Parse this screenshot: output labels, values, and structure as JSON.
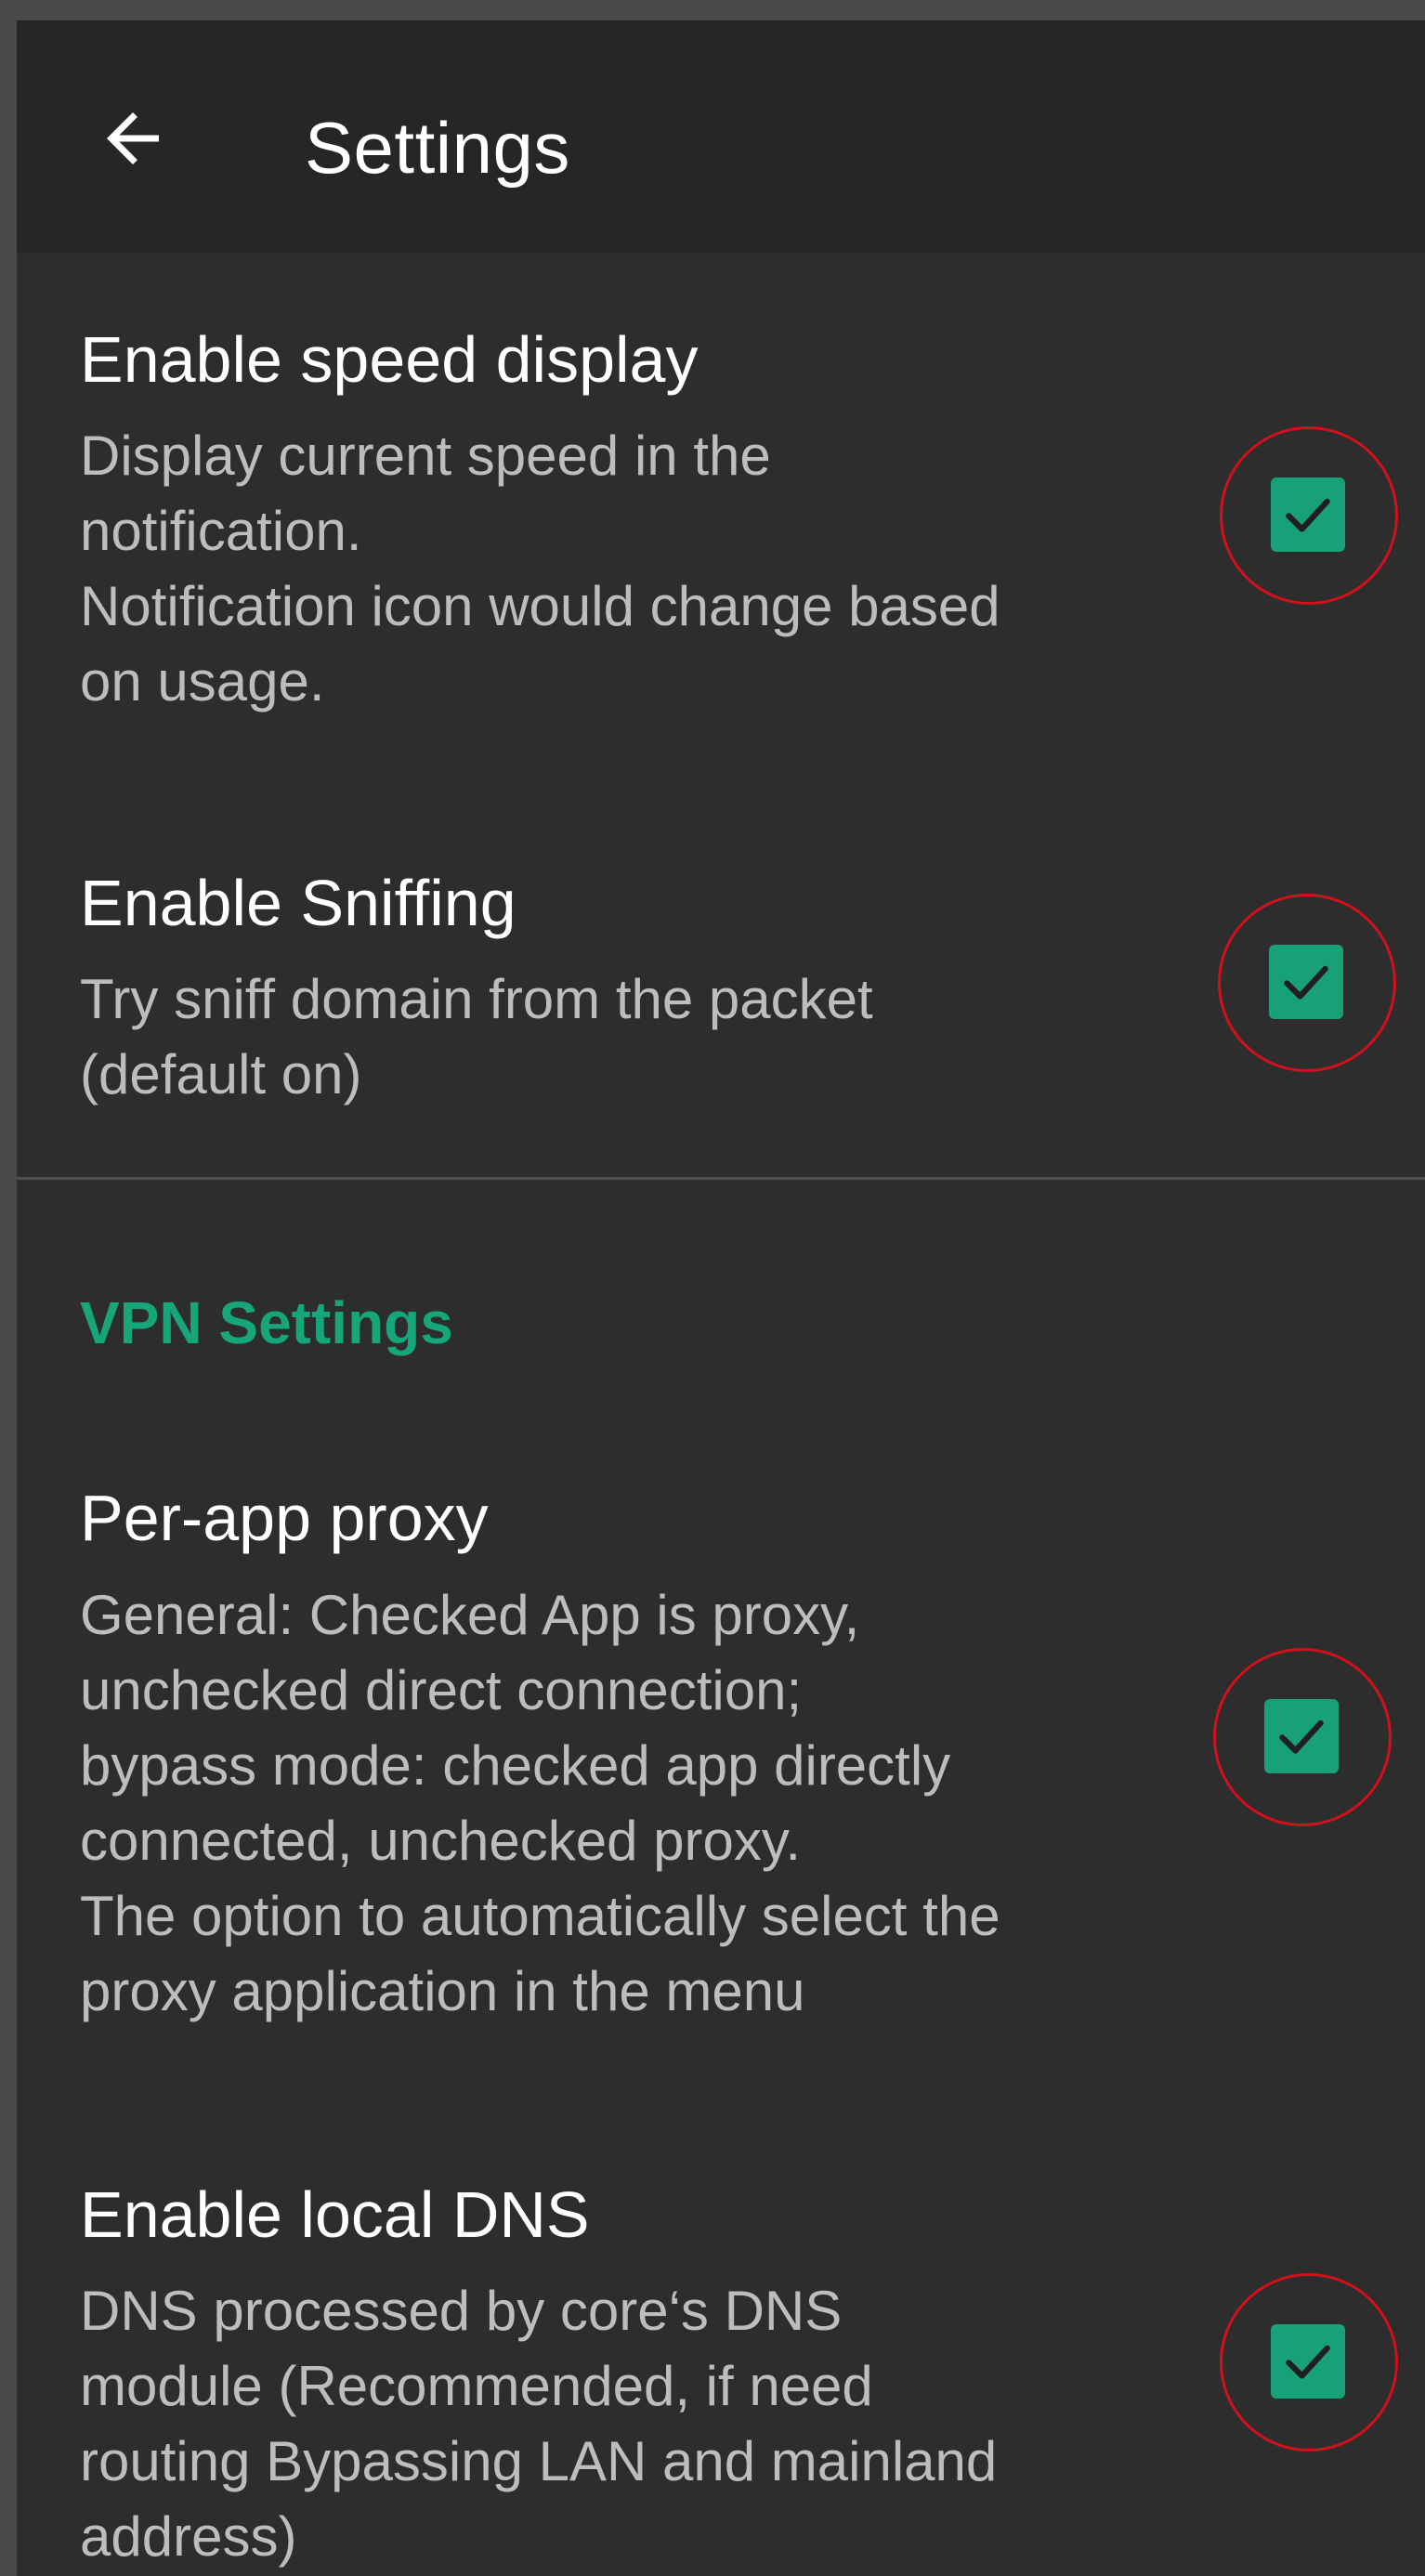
{
  "appbar": {
    "title": "Settings",
    "back_icon": "arrow-left-icon"
  },
  "prefs": [
    {
      "title": "Enable speed display",
      "summary": [
        "Display current speed in the",
        "notification.",
        "Notification icon would change based",
        "on usage."
      ],
      "checked": true
    },
    {
      "title": "Enable Sniffing",
      "summary": [
        "Try sniff domain from the packet",
        "(default on)"
      ],
      "checked": true
    },
    {
      "title": "Per-app proxy",
      "summary": [
        "General: Checked App is proxy,",
        "unchecked direct connection;",
        "bypass mode: checked app directly",
        "connected, unchecked proxy.",
        "The option to automatically select the",
        "proxy application in the menu"
      ],
      "checked": true
    },
    {
      "title": "Enable local DNS",
      "summary": [
        "DNS processed by core‘s DNS",
        "module (Recommended, if need",
        "routing Bypassing LAN and mainland",
        "address)"
      ],
      "checked": true
    }
  ],
  "section": {
    "vpn_header": "VPN Settings"
  },
  "colors": {
    "accent": "#17a57a",
    "checkbox": "#18a078",
    "annotation_ring": "#d0101a",
    "background": "#2d2d2d",
    "appbar": "#262626"
  }
}
